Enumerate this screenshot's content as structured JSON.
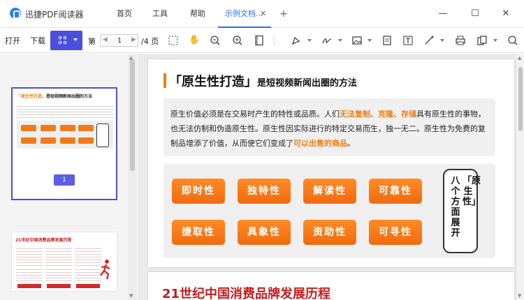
{
  "app": {
    "title": "迅捷PDF阅读器"
  },
  "tabs": [
    {
      "label": "首页"
    },
    {
      "label": "工具"
    },
    {
      "label": "帮助"
    },
    {
      "label": "示例文档...",
      "active": true
    }
  ],
  "window": {
    "minimize": "—",
    "maximize": "☐",
    "close": "✕"
  },
  "toolbar": {
    "open_label": "打开",
    "download_label": "下载",
    "page_label": "第",
    "page_value": "1",
    "page_total": "/4 页"
  },
  "sidebar": {
    "thumb1": {
      "title_a": "「原生性打造」",
      "title_b": "是短视频新闻出圈的方法"
    },
    "page_badge": "1",
    "thumb2": {
      "title": "21世纪中国消费品牌发展历程"
    }
  },
  "document": {
    "page1": {
      "title_main": "「原生性打造」",
      "title_sub": "是短视频新闻出圈的方法",
      "paragraph": {
        "p1": "原生价值必须是在交易时产生的特性或品质。人们",
        "h1": "无法复制、克隆、存储",
        "p2": "具有原生性的事物，也无法仿制和伪造原生性。原生性因实际进行的特定交易而生，独一无二。原生性为免费的复制品增添了价值，从而使它们变成了",
        "h2": "可以出售的商品",
        "p3": "。"
      },
      "features": [
        "即时性",
        "独特性",
        "解读性",
        "可靠性",
        "捷取性",
        "具象性",
        "资助性",
        "可寻性"
      ],
      "side_note_col1": "「原生性」",
      "side_note_col2": "八个方面展开"
    },
    "page2": {
      "title": "21世纪中国消费品牌发展历程"
    }
  },
  "colors": {
    "accent": "#4b4fe0",
    "highlight": "#f07c14",
    "feature": "#f27a1a",
    "page2_title": "#c41d1d"
  }
}
